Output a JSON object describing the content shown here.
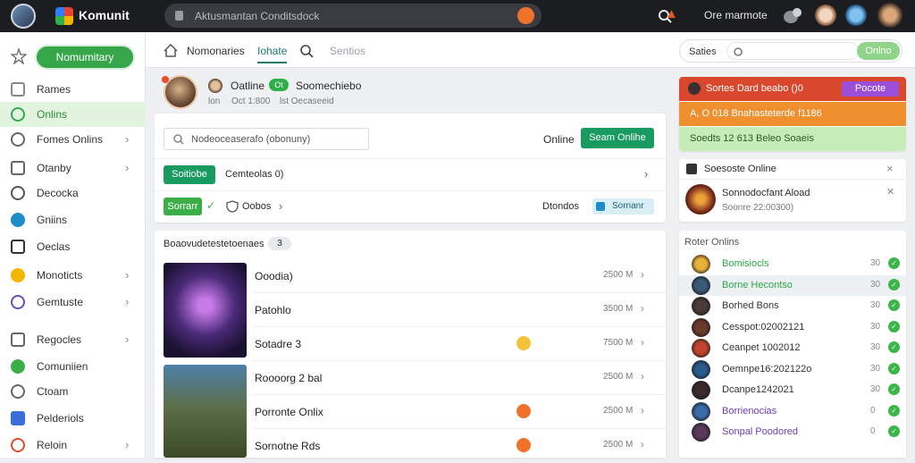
{
  "app": {
    "brand": "Komunit",
    "search_placeholder": "Aktusmantan Conditsdock",
    "user_name": "Ore marmote"
  },
  "sidebar": {
    "top_pill": "Nomumitary",
    "items": [
      {
        "label": "Rames",
        "icon": "controller-icon"
      },
      {
        "label": "Onlins",
        "icon": "clock-icon",
        "active": true
      },
      {
        "label": "Fomes Onlins",
        "icon": "grid-icon",
        "chevron": true
      },
      {
        "label": "Otanby",
        "icon": "document-icon",
        "chevron": true
      },
      {
        "label": "Decocka",
        "icon": "home-icon"
      },
      {
        "label": "Gniins",
        "icon": "globe-icon"
      },
      {
        "label": "Oeclas",
        "icon": "character-icon"
      },
      {
        "label": "Monoticts",
        "icon": "lightbulb-icon",
        "chevron": true
      },
      {
        "label": "Gemtuste",
        "icon": "monitor-icon",
        "chevron": true
      },
      {
        "label": "Regocles",
        "icon": "newspaper-icon",
        "chevron": true
      },
      {
        "label": "Comuniien",
        "icon": "ring-icon"
      },
      {
        "label": "Ctoam",
        "icon": "house-icon"
      },
      {
        "label": "Pelderiols",
        "icon": "users-icon"
      },
      {
        "label": "Reloin",
        "icon": "game-icon",
        "chevron": true
      }
    ]
  },
  "tabs": {
    "t1": "Nomonaries",
    "t2": "Iohate",
    "t3": "Sentios"
  },
  "right_search": {
    "label": "Saties",
    "button": "Onlno"
  },
  "profile": {
    "name": "Oatline",
    "badge": "Ot",
    "title": "Soomechiebo",
    "meta1": "lon",
    "meta2": "Oct 1:800",
    "meta3": "lst Oecaseeid"
  },
  "filter": {
    "placeholder": "Nodeoceaserafo (obonuny)",
    "online_label": "Online",
    "online_button": "Seam Onlihe",
    "green_btn": "Soitiobe",
    "sort_label": "Cemteolas 0)",
    "action_btn": "Sorrarr",
    "clock_label": "Oobos",
    "status_text": "Dtondos",
    "status_btn": "Sornanr"
  },
  "list": {
    "header": "Boaovudetestetoenaes",
    "count": "3",
    "rows": [
      {
        "name": "Ooodia)",
        "time": "2500 M",
        "badge": false
      },
      {
        "name": "Patohlo",
        "time": "3500 M",
        "badge": false
      },
      {
        "name": "Sotadre 3",
        "time": "7500 M",
        "badge": "yellow"
      },
      {
        "name": "Roooorg 2 bal",
        "time": "2500 M",
        "badge": false
      },
      {
        "name": "Porronte Onlix",
        "time": "2500 M",
        "badge": "orange"
      },
      {
        "name": "Sornotne Rds",
        "time": "2500 M",
        "badge": "orange"
      }
    ]
  },
  "strips": {
    "s1": "Sortes Dard beabo ()0",
    "s1_btn": "Pocote",
    "s2": "A, O 018 Bnahasteterde f1186",
    "s3": "Soedts 12 613 Beleo Soaeis"
  },
  "notif": {
    "header": "Soesoste Online",
    "name": "Sonnodocfant Aload",
    "time": "Soonre 22:00300)"
  },
  "friends": {
    "header": "Roter Onlins",
    "items": [
      {
        "name": "Bomisiocls",
        "count": "30",
        "color": "#2aa84a"
      },
      {
        "name": "Borne Hecontso",
        "count": "30",
        "color": "#2aa84a"
      },
      {
        "name": "Borhed Bons",
        "count": "30",
        "color": "#333333"
      },
      {
        "name": "Cesspot:02002121",
        "count": "30",
        "color": "#333333"
      },
      {
        "name": "Ceanpet 1002012",
        "count": "30",
        "color": "#333333"
      },
      {
        "name": "Oemnpe16:202122o",
        "count": "30",
        "color": "#333333"
      },
      {
        "name": "Dcanpe1242021",
        "count": "30",
        "color": "#333333"
      },
      {
        "name": "Borrienocias",
        "count": "0",
        "color": "#6b3fb5"
      },
      {
        "name": "Sonpal Poodored",
        "count": "0",
        "color": "#6b3fb5"
      }
    ]
  },
  "colors": {
    "accent": "#199a60",
    "active_bg": "#e3f4de",
    "topbar": "#1c1d20"
  }
}
